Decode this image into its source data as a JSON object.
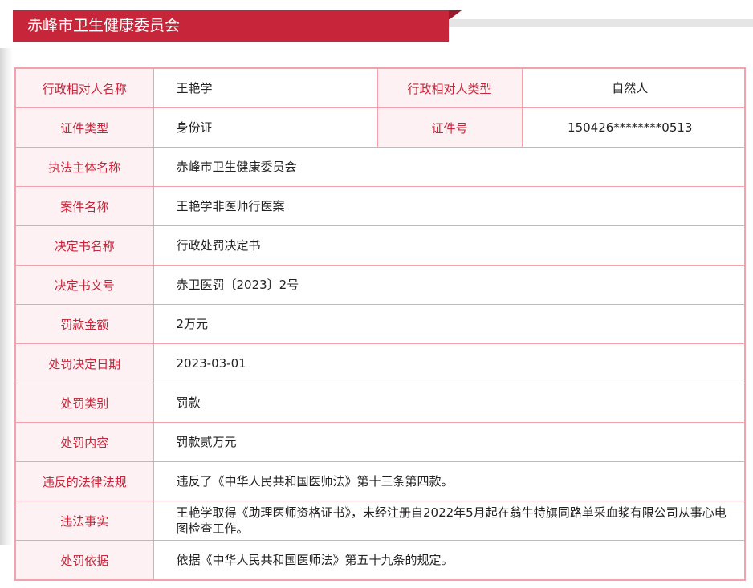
{
  "header": {
    "title": "赤峰市卫生健康委员会"
  },
  "record": {
    "party_name_label": "行政相对人名称",
    "party_name": "王艳学",
    "party_type_label": "行政相对人类型",
    "party_type": "自然人",
    "id_type_label": "证件类型",
    "id_type": "身份证",
    "id_number_label": "证件号",
    "id_number": "150426********0513",
    "rows": [
      {
        "label": "执法主体名称",
        "value": "赤峰市卫生健康委员会"
      },
      {
        "label": "案件名称",
        "value": "王艳学非医师行医案"
      },
      {
        "label": "决定书名称",
        "value": "行政处罚决定书"
      },
      {
        "label": "决定书文号",
        "value": "赤卫医罚〔2023〕2号"
      },
      {
        "label": "罚款金额",
        "value": "2万元"
      },
      {
        "label": "处罚决定日期",
        "value": "2023-03-01"
      },
      {
        "label": "处罚类别",
        "value": "罚款"
      },
      {
        "label": "处罚内容",
        "value": "罚款贰万元"
      },
      {
        "label": "违反的法律法规",
        "value": "违反了《中华人民共和国医师法》第十三条第四款。"
      },
      {
        "label": "违法事实",
        "value": "王艳学取得《助理医师资格证书》，未经注册自2022年5月起在翁牛特旗同路单采血浆有限公司从事心电图检查工作。"
      },
      {
        "label": "处罚依据",
        "value": "依据《中华人民共和国医师法》第五十九条的规定。"
      }
    ]
  }
}
